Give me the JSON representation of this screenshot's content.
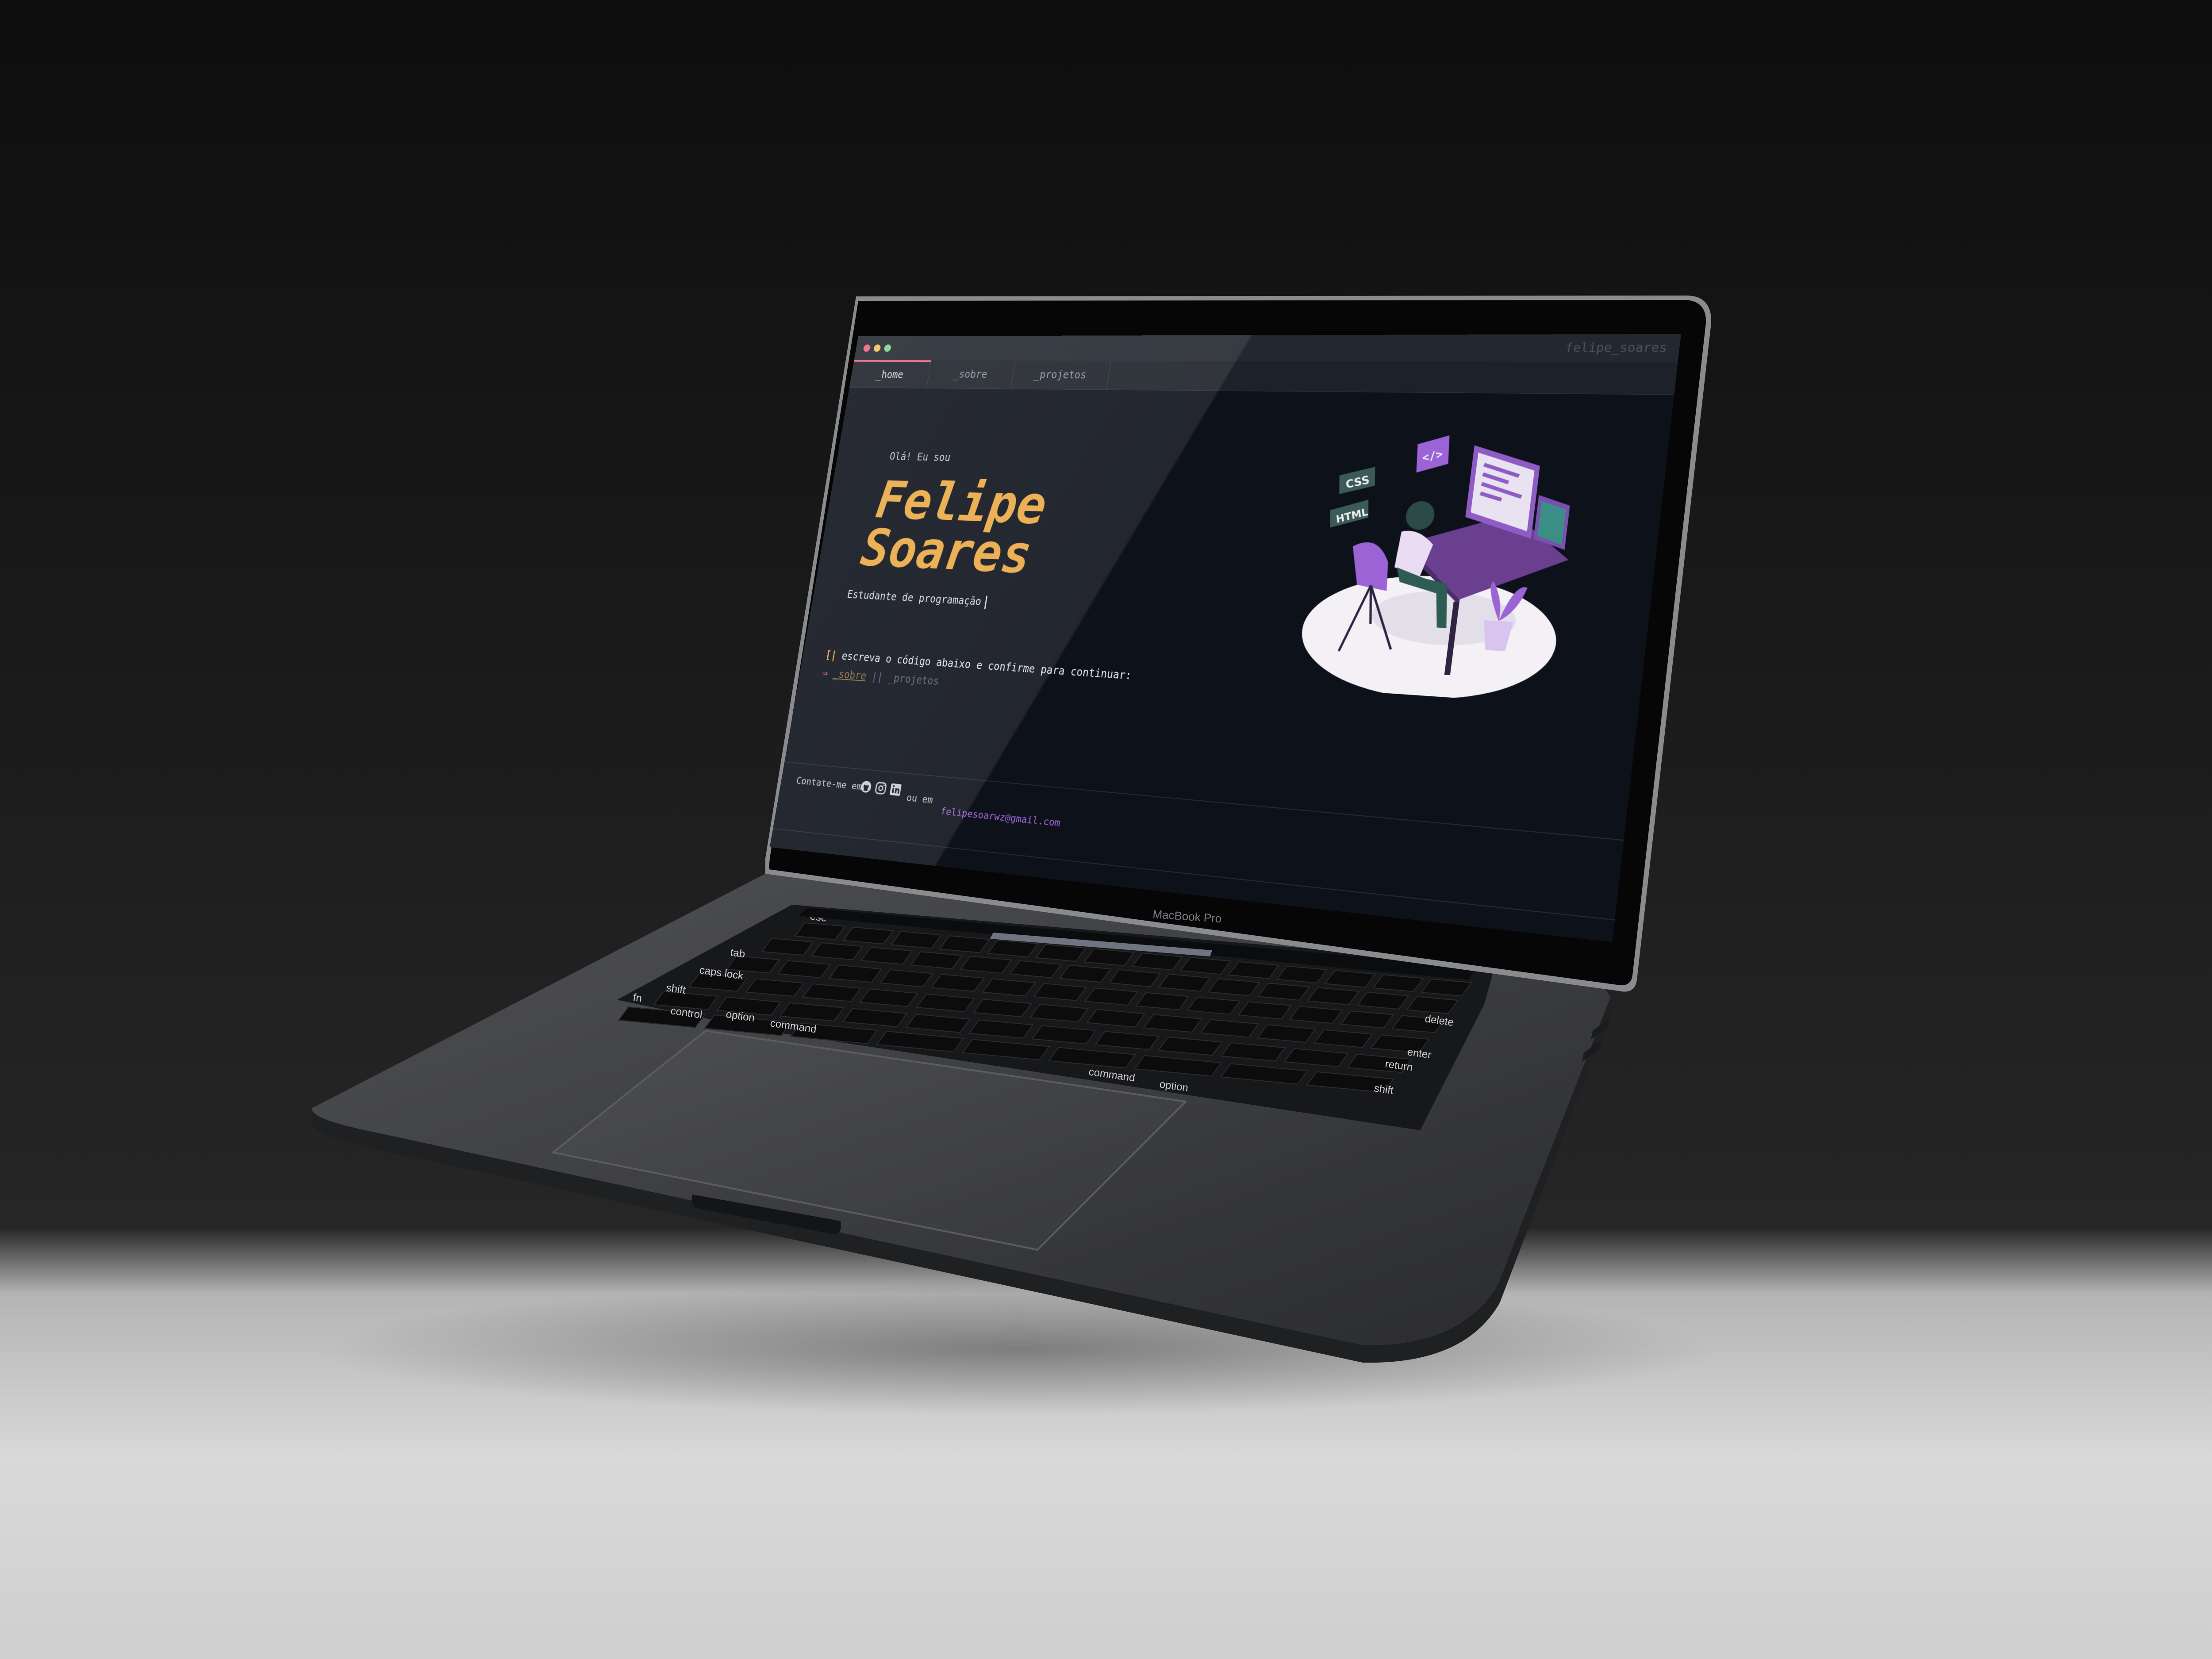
{
  "window": {
    "title": "felipe_soares",
    "traffic_lights": {
      "close": "#f1657c",
      "minimize": "#f3c15b",
      "maximize": "#7bd88f"
    }
  },
  "tabs": [
    {
      "label": "_home",
      "active": true
    },
    {
      "label": "_sobre",
      "active": false
    },
    {
      "label": "_projetos",
      "active": false
    }
  ],
  "hero": {
    "greeting": "Olá! Eu sou",
    "name_line1": "Felipe",
    "name_line2": "Soares",
    "role": "Estudante de programação"
  },
  "prompt": {
    "marker": "[|",
    "instruction": "escreva o código abaixo e confirme para continuar:",
    "arrow": "⇒",
    "option_sobre": "_sobre",
    "separator": "||",
    "option_projetos": "_projetos"
  },
  "illustration": {
    "badge_css": "CSS",
    "badge_html": "HTML",
    "badge_code": "</>"
  },
  "footer": {
    "contact_label": "Contate-me em:",
    "or_text": "ou em",
    "email": "felipesoarwz@gmail.com",
    "icons": [
      "github-icon",
      "instagram-icon",
      "linkedin-icon"
    ]
  },
  "device": {
    "brand": "MacBook Pro",
    "keys": {
      "esc": "esc",
      "tab": "tab",
      "caps": "caps lock",
      "shift_left": "shift",
      "fn": "fn",
      "control": "control",
      "option_left": "option",
      "command_left": "command",
      "delete": "delete",
      "enter": "enter",
      "return": "return",
      "shift_right": "shift",
      "command_right": "command",
      "option_right": "option"
    }
  },
  "colors": {
    "accent_name": "#eaa944",
    "accent_tab": "#f2678a",
    "link": "#a66be0",
    "screen_bg": "#0d111a"
  }
}
